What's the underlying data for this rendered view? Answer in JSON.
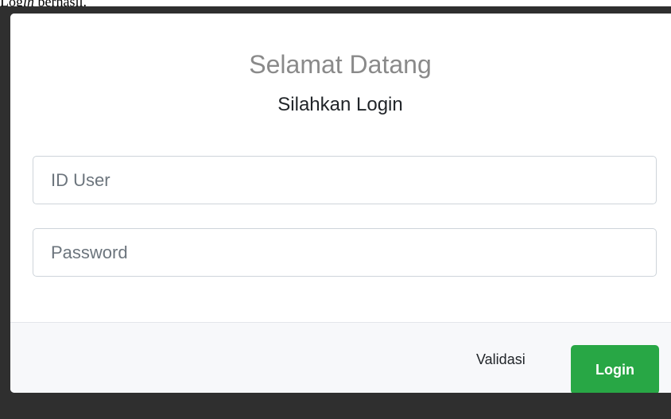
{
  "caption": {
    "prefix": "Log",
    "italic": "in",
    "suffix": " berhasil."
  },
  "modal": {
    "title": "Selamat Datang",
    "subtitle": "Silahkan Login",
    "fields": {
      "user_placeholder": "ID User",
      "user_value": "",
      "password_placeholder": "Password",
      "password_value": ""
    },
    "footer": {
      "validasi_label": "Validasi",
      "login_label": "Login"
    }
  },
  "colors": {
    "accent_green": "#28a745",
    "frame": "#2f2f2f",
    "footer_bg": "#f7f8fa",
    "title_gray": "#8a8a8a"
  }
}
